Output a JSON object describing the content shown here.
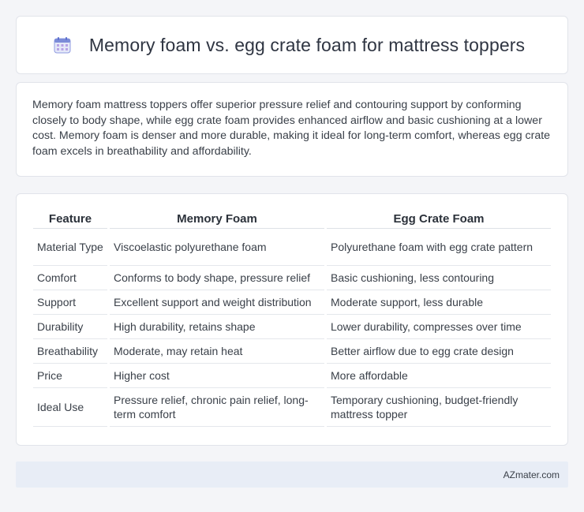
{
  "header": {
    "title": "Memory foam vs. egg crate foam for mattress toppers",
    "icon": "calendar-icon",
    "icon_color": "#7c8cd8"
  },
  "summary": {
    "text": "Memory foam mattress toppers offer superior pressure relief and contouring support by conforming closely to body shape, while egg crate foam provides enhanced airflow and basic cushioning at a lower cost. Memory foam is denser and more durable, making it ideal for long-term comfort, whereas egg crate foam excels in breathability and affordability."
  },
  "table": {
    "headers": [
      "Feature",
      "Memory Foam",
      "Egg Crate Foam"
    ],
    "rows": [
      [
        "Material Type",
        "Viscoelastic polyurethane foam",
        "Polyurethane foam with egg crate pattern"
      ],
      [
        "Comfort",
        "Conforms to body shape, pressure relief",
        "Basic cushioning, less contouring"
      ],
      [
        "Support",
        "Excellent support and weight distribution",
        "Moderate support, less durable"
      ],
      [
        "Durability",
        "High durability, retains shape",
        "Lower durability, compresses over time"
      ],
      [
        "Breathability",
        "Moderate, may retain heat",
        "Better airflow due to egg crate design"
      ],
      [
        "Price",
        "Higher cost",
        "More affordable"
      ],
      [
        "Ideal Use",
        "Pressure relief, chronic pain relief, long-term comfort",
        "Temporary cushioning, budget-friendly mattress topper"
      ]
    ]
  },
  "footer": {
    "brand": "AZmater.com"
  },
  "colors": {
    "background": "#f4f5f8",
    "card": "#ffffff",
    "footer_bg": "#e8edf6",
    "text": "#3a4049"
  }
}
